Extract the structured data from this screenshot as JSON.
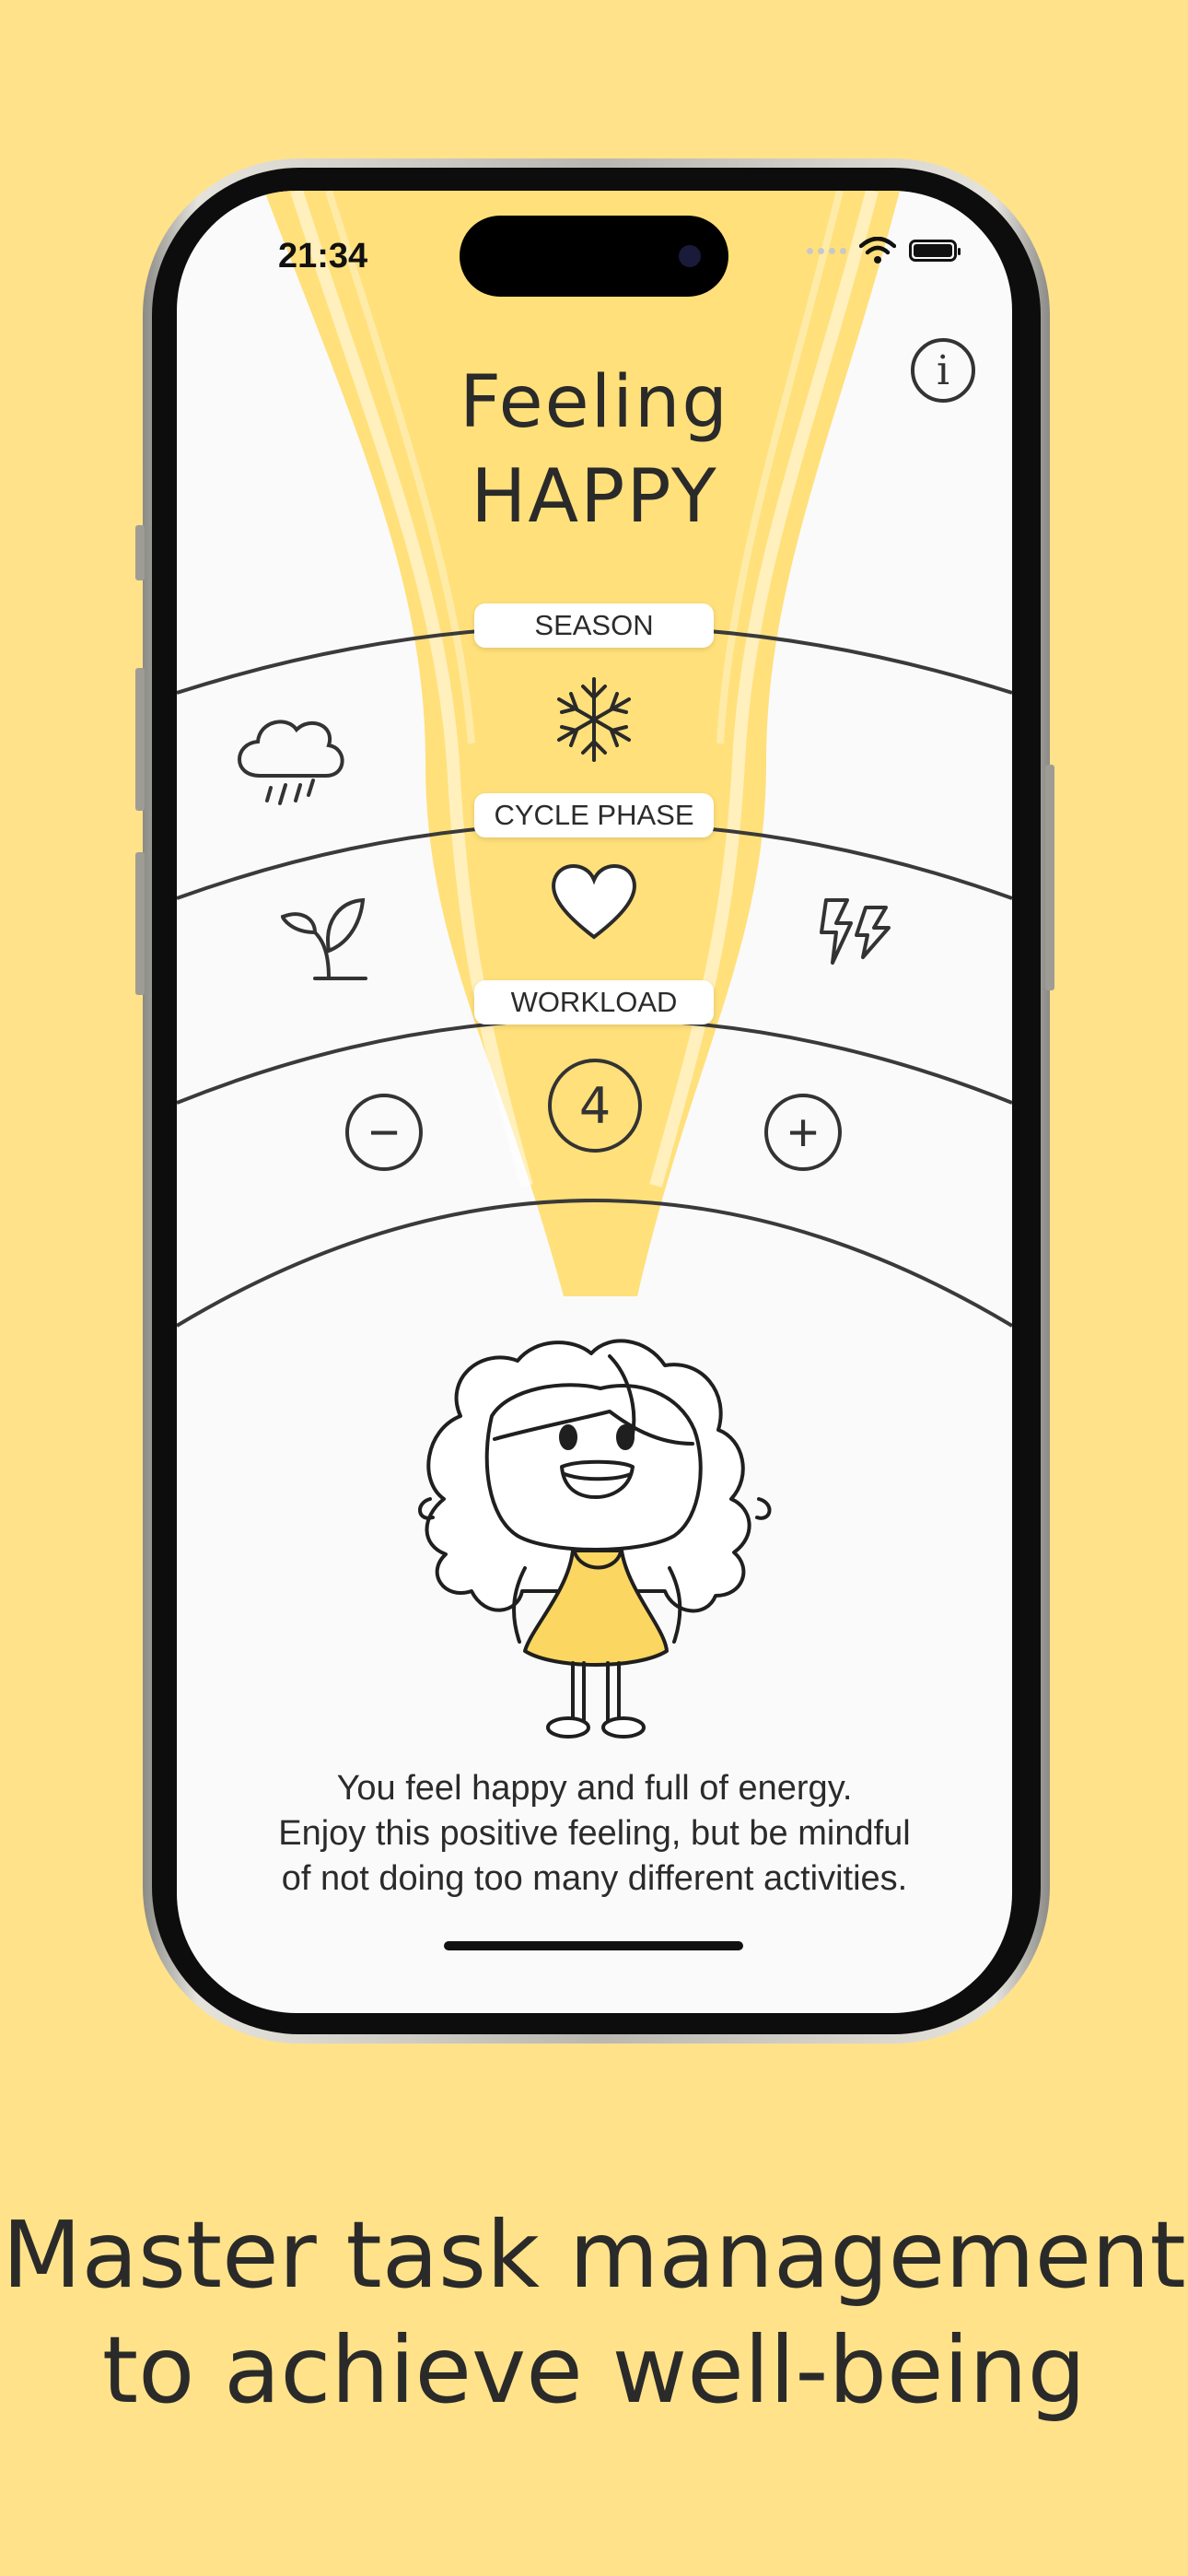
{
  "status_bar": {
    "time": "21:34"
  },
  "header": {
    "line1": "Feeling",
    "line2": "HAPPY"
  },
  "info_button": {
    "icon": "info-icon",
    "label": "i"
  },
  "sections": {
    "season": {
      "label": "SEASON",
      "selected_icon": "snowflake-icon",
      "left_icon": "rain-cloud-icon"
    },
    "cycle_phase": {
      "label": "CYCLE PHASE",
      "selected_icon": "heart-icon",
      "left_icon": "sprout-icon",
      "right_icon": "lightning-icon"
    },
    "workload": {
      "label": "WORKLOAD",
      "value": "4",
      "minus": "−",
      "plus": "+"
    }
  },
  "message": {
    "line1": "You feel happy and full of energy.",
    "line2": "Enjoy this positive feeling, but be mindful",
    "line3": "of not doing too many different activities."
  },
  "caption": {
    "line1": "Master task management",
    "line2": "to achieve well-being"
  },
  "colors": {
    "background": "#FFE28A",
    "beam": "#FFE07A",
    "dress": "#FBD660",
    "screen": "#FAFAFA",
    "ink": "#2b2b2b"
  }
}
